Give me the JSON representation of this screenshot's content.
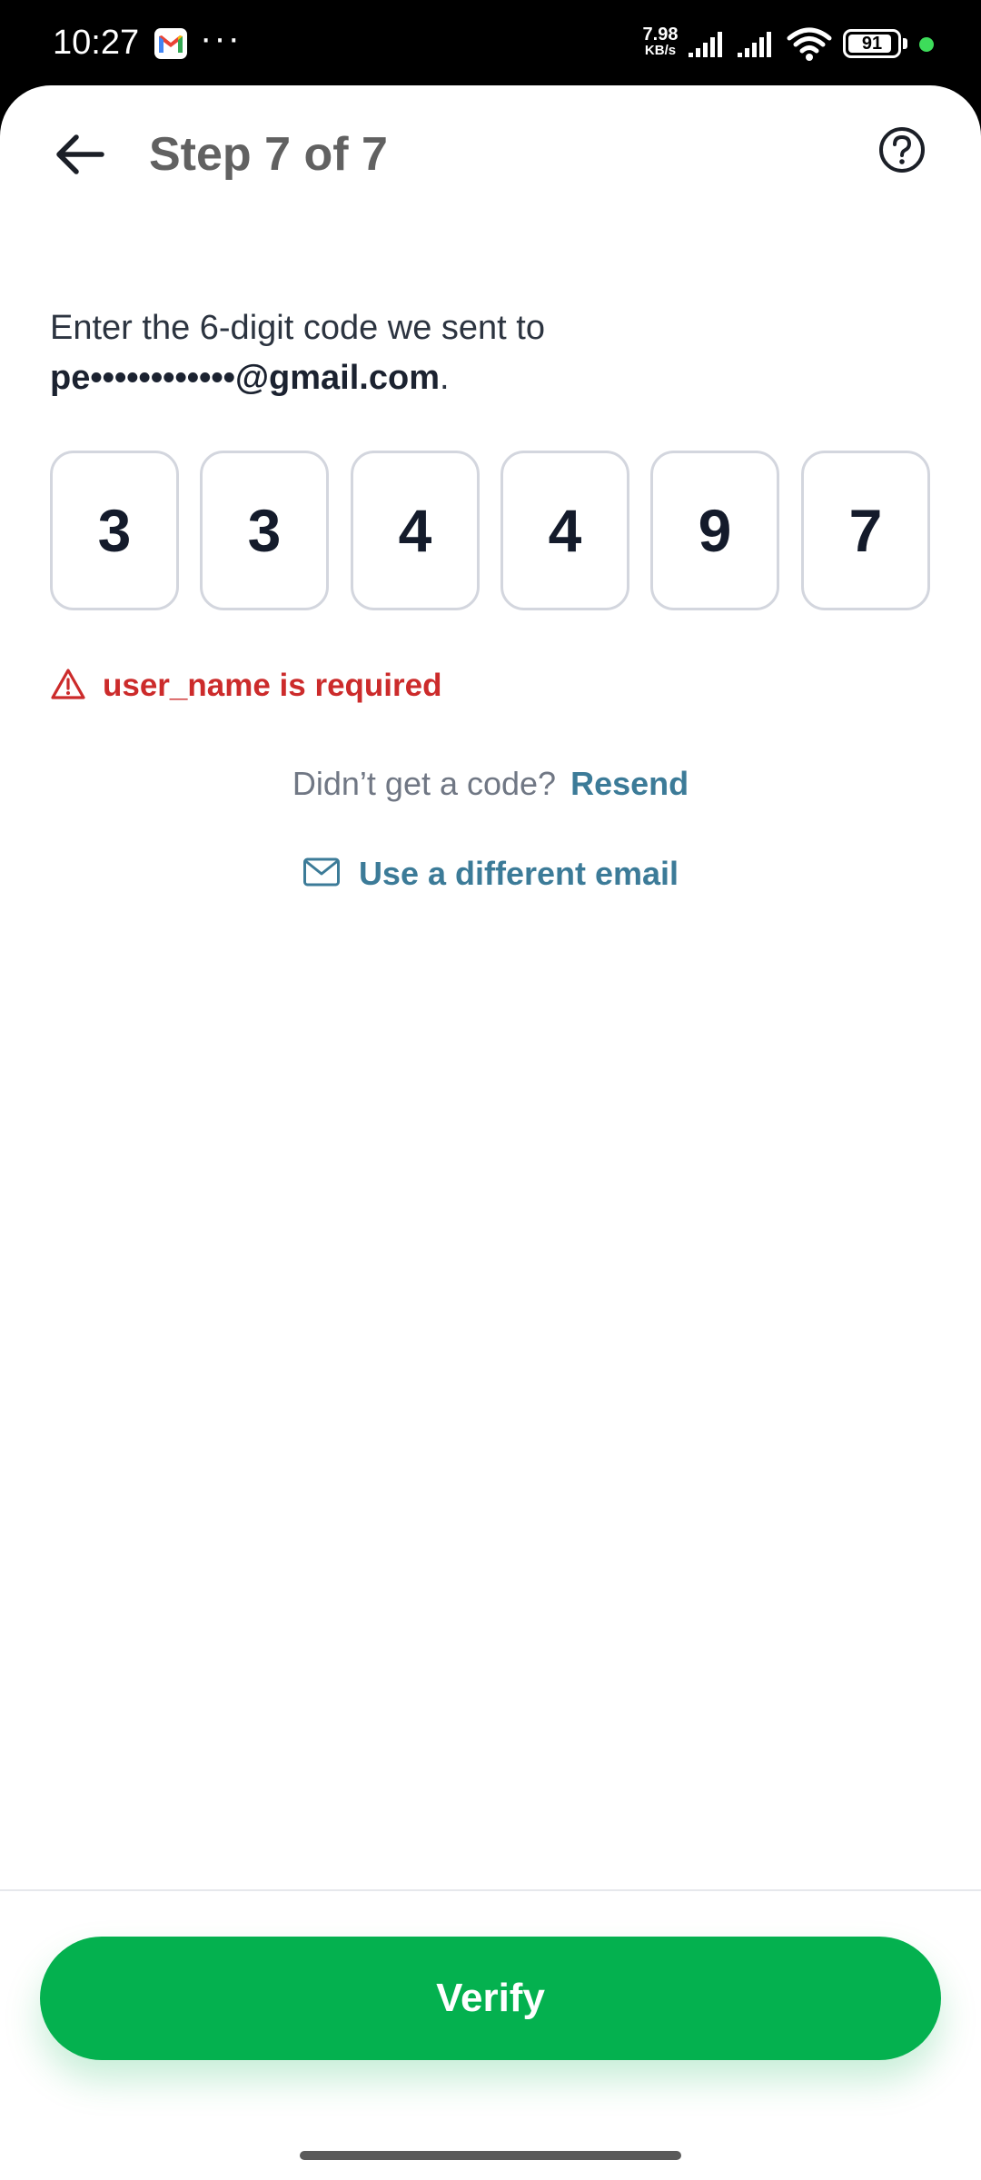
{
  "status_bar": {
    "time": "10:27",
    "notification_icons": [
      "gmail-icon",
      "more-dots-icon"
    ],
    "more_dots": "···",
    "net_speed_value": "7.98",
    "net_speed_unit": "KB/s",
    "battery_level": "91",
    "battery_fraction": 0.91,
    "dot_color": "#3ddc5a"
  },
  "header": {
    "back_icon": "arrow-left-icon",
    "title": "Step 7 of 7",
    "help_icon": "question-circle-icon"
  },
  "instructions": {
    "prefix": "Enter the 6-digit code we sent to",
    "email": "pe••••••••••••@gmail.com",
    "suffix": "."
  },
  "code": {
    "digits": [
      "3",
      "3",
      "4",
      "4",
      "9",
      "7"
    ]
  },
  "error": {
    "icon": "warning-triangle-icon",
    "message": "user_name is required",
    "color": "#cc2b2b"
  },
  "resend": {
    "prompt": "Didn’t get a code?",
    "link_label": "Resend"
  },
  "different_email": {
    "icon": "mail-icon",
    "label": "Use a different email"
  },
  "verify": {
    "label": "Verify",
    "color": "#04b14f"
  },
  "colors": {
    "accent_link": "#3c7b98",
    "primary": "#04b14f",
    "error": "#cc2b2b"
  }
}
